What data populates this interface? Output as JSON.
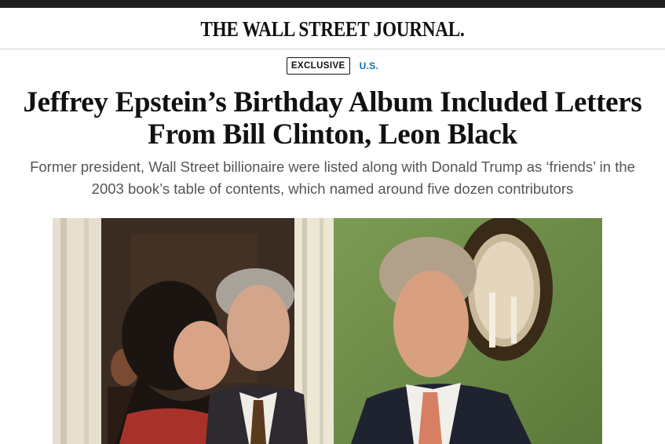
{
  "masthead": {
    "title": "THE WALL STREET JOURNAL."
  },
  "article": {
    "flag_label": "EXCLUSIVE",
    "section_label": "U.S.",
    "headline_line1": "Jeffrey Epstein’s Birthday Album Included Letters",
    "headline_line2": "From Bill Clinton, Leon Black",
    "dek_line1": "Former president, Wall Street billionaire were listed along with Donald Trump as ‘friends’ in the",
    "dek_line2": "2003 book’s table of contents, which named around five dozen contributors"
  },
  "colors": {
    "accent": "#0274b6",
    "top_bar": "#1e1e1e",
    "wall_green": "#6f8f49",
    "headline": "#111111",
    "dek": "#555555"
  }
}
